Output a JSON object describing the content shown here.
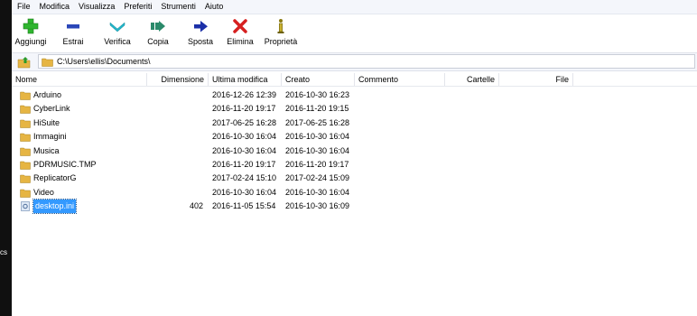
{
  "desktop_edge_label": "cs",
  "menu": [
    "File",
    "Modifica",
    "Visualizza",
    "Preferiti",
    "Strumenti",
    "Aiuto"
  ],
  "toolbar": {
    "add_label": "Aggiungi",
    "extract_label": "Estrai",
    "test_label": "Verifica",
    "copy_label": "Copia",
    "move_label": "Sposta",
    "delete_label": "Elimina",
    "info_label": "Proprietà"
  },
  "address": {
    "path": "C:\\Users\\ellis\\Documents\\"
  },
  "columns": {
    "name": "Nome",
    "size": "Dimensione",
    "modified": "Ultima modifica",
    "created": "Creato",
    "comment": "Commento",
    "folders": "Cartelle",
    "files": "File"
  },
  "rows": [
    {
      "name": "Arduino",
      "size": "",
      "modified": "2016-12-26 12:39",
      "created": "2016-10-30 16:23",
      "type": "folder"
    },
    {
      "name": "CyberLink",
      "size": "",
      "modified": "2016-11-20 19:17",
      "created": "2016-11-20 19:15",
      "type": "folder"
    },
    {
      "name": "HiSuite",
      "size": "",
      "modified": "2017-06-25 16:28",
      "created": "2017-06-25 16:28",
      "type": "folder"
    },
    {
      "name": "Immagini",
      "size": "",
      "modified": "2016-10-30 16:04",
      "created": "2016-10-30 16:04",
      "type": "folder"
    },
    {
      "name": "Musica",
      "size": "",
      "modified": "2016-10-30 16:04",
      "created": "2016-10-30 16:04",
      "type": "folder"
    },
    {
      "name": "PDRMUSIC.TMP",
      "size": "",
      "modified": "2016-11-20 19:17",
      "created": "2016-11-20 19:17",
      "type": "folder"
    },
    {
      "name": "ReplicatorG",
      "size": "",
      "modified": "2017-02-24 15:10",
      "created": "2017-02-24 15:09",
      "type": "folder"
    },
    {
      "name": "Video",
      "size": "",
      "modified": "2016-10-30 16:04",
      "created": "2016-10-30 16:04",
      "type": "folder"
    },
    {
      "name": "desktop.ini",
      "size": "402",
      "modified": "2016-11-05 15:54",
      "created": "2016-10-30 16:09",
      "type": "file",
      "selected": true
    }
  ],
  "colors": {
    "add": "#2fb52f",
    "extract": "#2a47b8",
    "test": "#23b5c9",
    "copy": "#2a8a6a",
    "move": "#1b2fa8",
    "delete": "#d62020",
    "info": "#8a7a10",
    "folder": "#e6b543",
    "selection": "#3399ff"
  }
}
